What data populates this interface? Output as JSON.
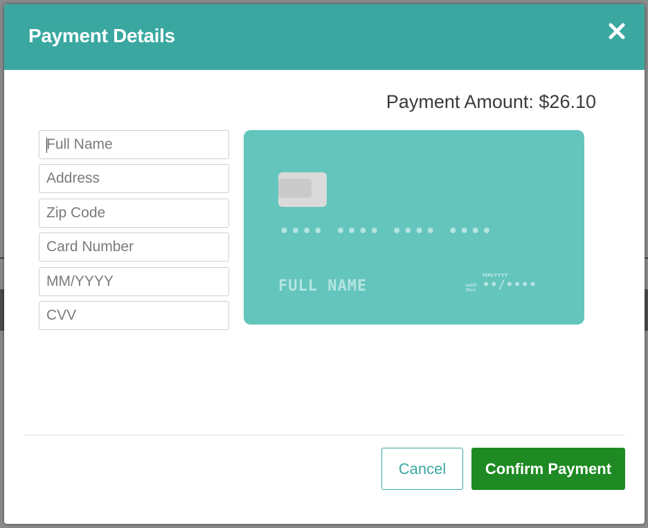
{
  "modal": {
    "title": "Payment Details",
    "close_icon": "close-icon"
  },
  "payment": {
    "amount_label": "Payment Amount: $26.10"
  },
  "form": {
    "full_name_placeholder": "Full Name",
    "address_placeholder": "Address",
    "zip_placeholder": "Zip Code",
    "card_number_placeholder": "Card Number",
    "expiry_placeholder": "MM/YYYY",
    "cvv_placeholder": "CVV"
  },
  "card_preview": {
    "number": "•••• •••• •••• ••••",
    "name": "FULL NAME",
    "expiry_format": "MM/YYYY",
    "valid_label": "valid thru",
    "expiry": "••/••••",
    "chip_icon": "card-chip-icon"
  },
  "footer": {
    "cancel_label": "Cancel",
    "confirm_label": "Confirm Payment"
  },
  "colors": {
    "header": "#3aa8a1",
    "card": "#64c5bd",
    "confirm": "#1f8a23"
  }
}
